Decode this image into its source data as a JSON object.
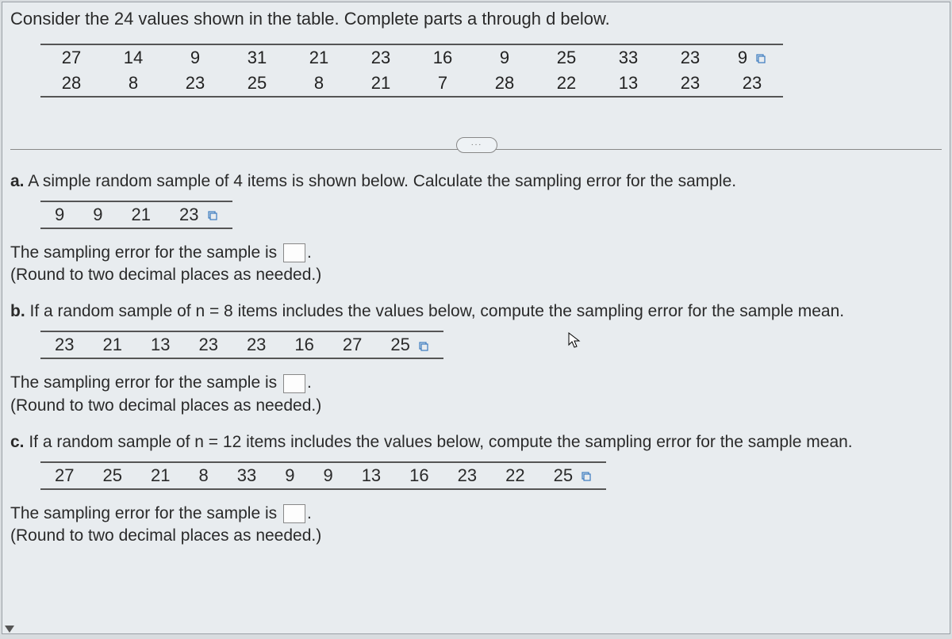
{
  "intro": "Consider the 24 values shown in the table. Complete parts a through d below.",
  "data_table": {
    "row1": [
      "27",
      "14",
      "9",
      "31",
      "21",
      "23",
      "16",
      "9",
      "25",
      "33",
      "23",
      "9"
    ],
    "row2": [
      "28",
      "8",
      "23",
      "25",
      "8",
      "21",
      "7",
      "28",
      "22",
      "13",
      "23",
      "23"
    ]
  },
  "ellipsis": "...",
  "parts": {
    "a": {
      "label": "a.",
      "prompt": " A simple random sample of 4 items is shown below. Calculate the sampling error for the sample.",
      "sample": [
        "9",
        "9",
        "21",
        "23"
      ],
      "answer_line_pre": "The sampling error for the sample is ",
      "answer_line_post": ".",
      "round": "(Round to two decimal places as needed.)"
    },
    "b": {
      "label": "b.",
      "prompt": " If a random sample of n = 8 items includes the values below, compute the sampling error for the sample mean.",
      "sample": [
        "23",
        "21",
        "13",
        "23",
        "23",
        "16",
        "27",
        "25"
      ],
      "answer_line_pre": "The sampling error for the sample is ",
      "answer_line_post": ".",
      "round": "(Round to two decimal places as needed.)"
    },
    "c": {
      "label": "c.",
      "prompt": " If a random sample of n = 12 items includes the values below, compute the sampling error for the sample mean.",
      "sample": [
        "27",
        "25",
        "21",
        "8",
        "33",
        "9",
        "9",
        "13",
        "16",
        "23",
        "22",
        "25"
      ],
      "answer_line_pre": "The sampling error for the sample is ",
      "answer_line_post": ".",
      "round": "(Round to two decimal places as needed.)"
    }
  }
}
